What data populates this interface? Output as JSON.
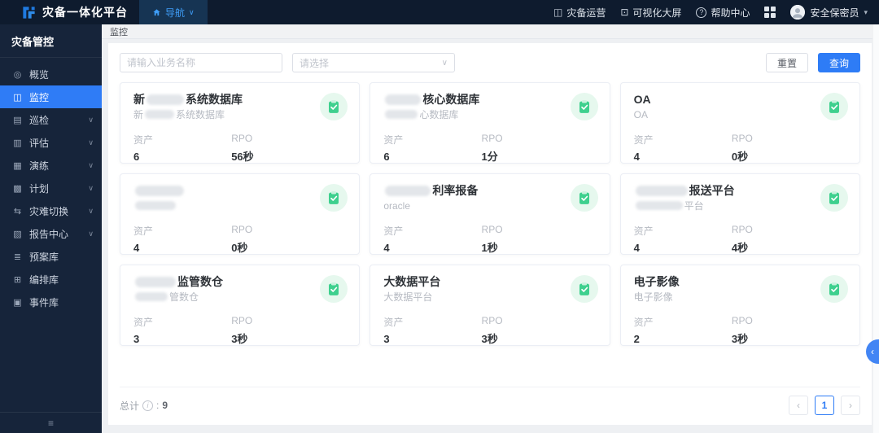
{
  "topbar": {
    "brand": "灾备一体化平台",
    "nav_label": "导航",
    "links": [
      {
        "label": "灾备运营",
        "icon": "ops-monitor-icon"
      },
      {
        "label": "可视化大屏",
        "icon": "big-screen-icon"
      },
      {
        "label": "帮助中心",
        "icon": "help-icon"
      }
    ],
    "user": "安全保密员"
  },
  "sidebar": {
    "title": "灾备管控",
    "items": [
      {
        "label": "概览",
        "icon": "overview-icon",
        "expandable": false,
        "active": false
      },
      {
        "label": "监控",
        "icon": "monitor-icon",
        "expandable": false,
        "active": true
      },
      {
        "label": "巡检",
        "icon": "inspection-icon",
        "expandable": true,
        "active": false
      },
      {
        "label": "评估",
        "icon": "evaluation-icon",
        "expandable": true,
        "active": false
      },
      {
        "label": "演练",
        "icon": "drill-icon",
        "expandable": true,
        "active": false
      },
      {
        "label": "计划",
        "icon": "plan-icon",
        "expandable": true,
        "active": false
      },
      {
        "label": "灾难切换",
        "icon": "switchover-icon",
        "expandable": true,
        "active": false
      },
      {
        "label": "报告中心",
        "icon": "report-center-icon",
        "expandable": true,
        "active": false
      },
      {
        "label": "预案库",
        "icon": "plan-library-icon",
        "expandable": false,
        "active": false
      },
      {
        "label": "编排库",
        "icon": "orchestration-library-icon",
        "expandable": false,
        "active": false
      },
      {
        "label": "事件库",
        "icon": "event-library-icon",
        "expandable": false,
        "active": false
      }
    ]
  },
  "page": {
    "tab": "监控",
    "search_placeholder": "请输入业务名称",
    "select_placeholder": "请选择",
    "reset_label": "重置",
    "query_label": "查询",
    "total_label": "总计",
    "total_colon": ":",
    "total_value": "9",
    "page_number": "1"
  },
  "card_labels": {
    "asset": "资产",
    "rpo": "RPO"
  },
  "cards": [
    {
      "title_pre": "新",
      "title_redact_w": 46,
      "title_post": "系统数据库",
      "sub_pre": "新",
      "sub_redact_w": 36,
      "sub_post": "系统数据库",
      "asset": "6",
      "rpo": "56秒"
    },
    {
      "title_pre": "",
      "title_redact_w": 44,
      "title_post": "核心数据库",
      "sub_pre": "",
      "sub_redact_w": 40,
      "sub_post": "心数据库",
      "asset": "6",
      "rpo": "1分"
    },
    {
      "title_pre": "OA",
      "title_redact_w": 0,
      "title_post": "",
      "sub_pre": "OA",
      "sub_redact_w": 0,
      "sub_post": "",
      "asset": "4",
      "rpo": "0秒"
    },
    {
      "title_pre": "",
      "title_redact_w": 60,
      "title_post": "",
      "sub_pre": "",
      "sub_redact_w": 50,
      "sub_post": "",
      "asset": "4",
      "rpo": "0秒"
    },
    {
      "title_pre": "",
      "title_redact_w": 56,
      "title_post": "利率报备",
      "sub_pre": "oracle",
      "sub_redact_w": 0,
      "sub_post": "",
      "asset": "4",
      "rpo": "1秒"
    },
    {
      "title_pre": "",
      "title_redact_w": 64,
      "title_post": "报送平台",
      "sub_pre": "",
      "sub_redact_w": 58,
      "sub_post": "平台",
      "asset": "4",
      "rpo": "4秒"
    },
    {
      "title_pre": "",
      "title_redact_w": 50,
      "title_post": "监管数仓",
      "sub_pre": "",
      "sub_redact_w": 40,
      "sub_post": "管数仓",
      "asset": "3",
      "rpo": "3秒"
    },
    {
      "title_pre": "大数据平台",
      "title_redact_w": 0,
      "title_post": "",
      "sub_pre": "大数据平台",
      "sub_redact_w": 0,
      "sub_post": "",
      "asset": "3",
      "rpo": "3秒"
    },
    {
      "title_pre": "电子影像",
      "title_redact_w": 0,
      "title_post": "",
      "sub_pre": "电子影像",
      "sub_redact_w": 0,
      "sub_post": "",
      "asset": "2",
      "rpo": "3秒"
    }
  ],
  "icons": {
    "chevron_down": "∨",
    "chevron_left": "‹",
    "chevron_right": "›",
    "caret_down": "▾",
    "collapse": "≡",
    "info": "i"
  },
  "colors": {
    "accent_blue": "#2e7cf6",
    "status_green": "#3ed08e",
    "topbar_bg": "#0e1b2e",
    "sidebar_bg": "#16243a"
  }
}
